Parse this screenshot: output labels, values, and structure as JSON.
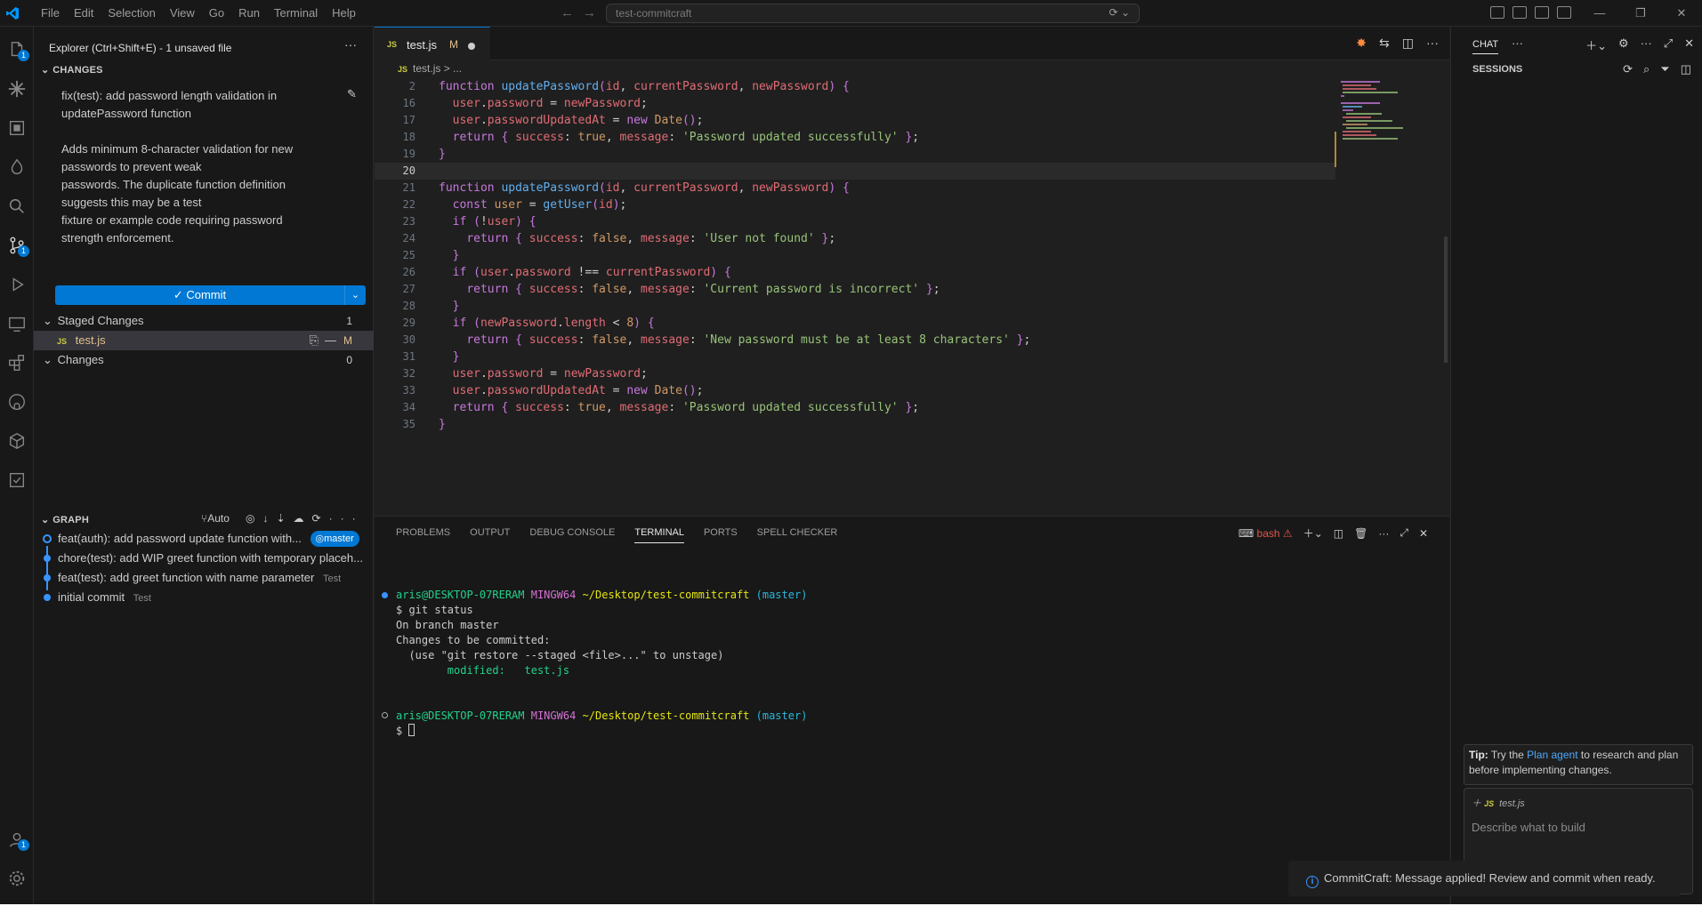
{
  "menu": [
    "File",
    "Edit",
    "Selection",
    "View",
    "Go",
    "Run",
    "Terminal",
    "Help"
  ],
  "command_center": "test-commitcraft",
  "sidebar": {
    "title": "Explorer (Ctrl+Shift+E) - 1 unsaved file",
    "changes_header": "CHANGES",
    "commit_message": "fix(test): add password length validation in\nupdatePassword function\n\nAdds minimum 8-character validation for new\npasswords to prevent weak\npasswords. The duplicate function definition\nsuggests this may be a test\nfixture or example code requiring password\nstrength enforcement.",
    "commit_label": "Commit",
    "staged_label": "Staged Changes",
    "staged_count": "1",
    "staged_file": "test.js",
    "staged_status": "M",
    "changes_label": "Changes",
    "changes_count": "0",
    "graph_header": "GRAPH",
    "graph_auto": "Auto",
    "graph": [
      {
        "message": "feat(auth): add password update function with...",
        "tag": "master",
        "author": ""
      },
      {
        "message": "chore(test): add WIP greet function with temporary placeh...",
        "tag": "",
        "author": ""
      },
      {
        "message": "feat(test): add greet function with name parameter",
        "tag": "",
        "author": "Test"
      },
      {
        "message": "initial commit",
        "tag": "",
        "author": "Test"
      }
    ]
  },
  "editor": {
    "tab_name": "test.js",
    "tab_status": "M",
    "breadcrumb": "test.js > ...",
    "lines": [
      {
        "n": "2",
        "cur": false
      },
      {
        "n": "16",
        "cur": false
      },
      {
        "n": "17",
        "cur": false
      },
      {
        "n": "18",
        "cur": false
      },
      {
        "n": "19",
        "cur": false
      },
      {
        "n": "20",
        "cur": true
      },
      {
        "n": "21",
        "cur": false
      },
      {
        "n": "22",
        "cur": false
      },
      {
        "n": "23",
        "cur": false
      },
      {
        "n": "24",
        "cur": false
      },
      {
        "n": "25",
        "cur": false
      },
      {
        "n": "26",
        "cur": false
      },
      {
        "n": "27",
        "cur": false
      },
      {
        "n": "28",
        "cur": false
      },
      {
        "n": "29",
        "cur": false
      },
      {
        "n": "30",
        "cur": false
      },
      {
        "n": "31",
        "cur": false
      },
      {
        "n": "32",
        "cur": false
      },
      {
        "n": "33",
        "cur": false
      },
      {
        "n": "34",
        "cur": false
      },
      {
        "n": "35",
        "cur": false
      }
    ]
  },
  "panel": {
    "tabs": [
      "PROBLEMS",
      "OUTPUT",
      "DEBUG CONSOLE",
      "TERMINAL",
      "PORTS",
      "SPELL CHECKER"
    ],
    "active_tab": "TERMINAL",
    "shell": "bash",
    "prompt_user": "aris@DESKTOP-07RERAM",
    "prompt_sys": "MINGW64",
    "prompt_path": "~/Desktop/test-commitcraft",
    "prompt_branch": "(master)",
    "cmd1": "$ git status",
    "out1": "On branch master",
    "out2": "Changes to be committed:",
    "out3": "  (use \"git restore --staged <file>...\" to unstage)",
    "out4_label": "        modified:   ",
    "out4_file": "test.js",
    "cmd2": "$ "
  },
  "chat": {
    "title": "CHAT",
    "sessions": "SESSIONS",
    "tip_prefix": "Tip:",
    "tip_pre": " Try the ",
    "tip_link": "Plan agent",
    "tip_post": " to research and plan before implementing changes.",
    "context_file": "test.js",
    "placeholder": "Describe what to build"
  },
  "notification": "CommitCraft: Message applied! Review and commit when ready.",
  "colors": {
    "accent": "#0078d4",
    "background": "#1f1f1f",
    "sidebar": "#181818"
  }
}
